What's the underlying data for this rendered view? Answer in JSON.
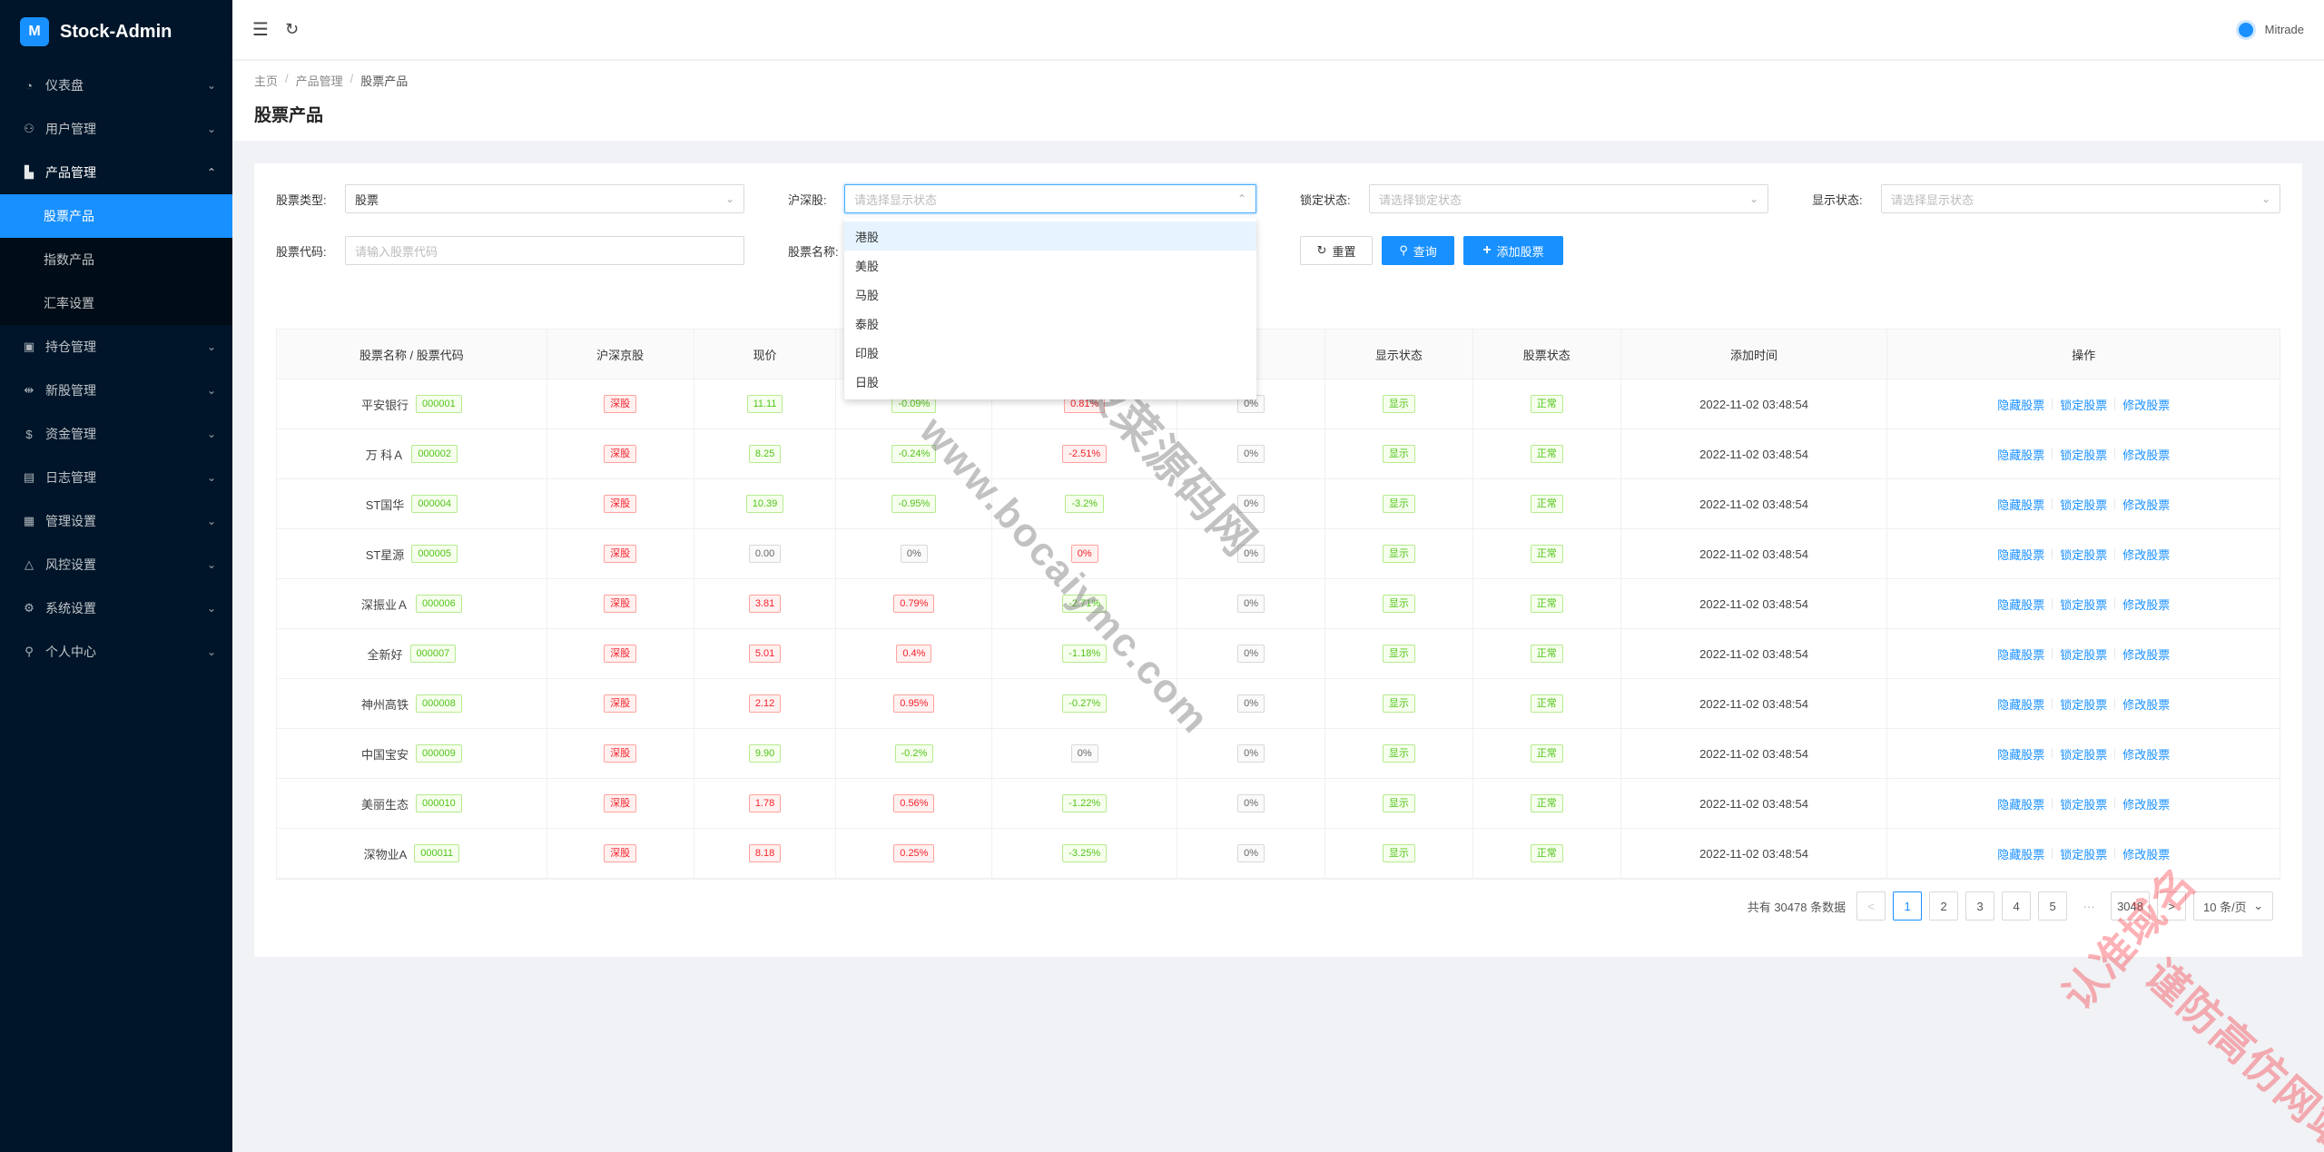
{
  "app": {
    "title": "Stock-Admin",
    "logo_letter": "M"
  },
  "sidebar": {
    "items": [
      {
        "label": "仪表盘",
        "icon": "dashboard-icon",
        "glyph": "◔",
        "arrow": "⌄"
      },
      {
        "label": "用户管理",
        "icon": "users-icon",
        "glyph": "⚇",
        "arrow": "⌄"
      },
      {
        "label": "产品管理",
        "icon": "chart-icon",
        "glyph": "▙",
        "arrow": "⌃"
      },
      {
        "label": "持仓管理",
        "icon": "position-icon",
        "glyph": "▣",
        "arrow": "⌄"
      },
      {
        "label": "新股管理",
        "icon": "ipo-icon",
        "glyph": "⇹",
        "arrow": "⌄"
      },
      {
        "label": "资金管理",
        "icon": "money-icon",
        "glyph": "$",
        "arrow": "⌄"
      },
      {
        "label": "日志管理",
        "icon": "log-icon",
        "glyph": "▤",
        "arrow": "⌄"
      },
      {
        "label": "管理设置",
        "icon": "settings-panel-icon",
        "glyph": "▦",
        "arrow": "⌄"
      },
      {
        "label": "风控设置",
        "icon": "warning-icon",
        "glyph": "△",
        "arrow": "⌄"
      },
      {
        "label": "系统设置",
        "icon": "gear-icon",
        "glyph": "⚙",
        "arrow": "⌄"
      },
      {
        "label": "个人中心",
        "icon": "user-icon",
        "glyph": "⚲",
        "arrow": "⌄"
      }
    ],
    "submenu": [
      {
        "label": "股票产品",
        "active": true
      },
      {
        "label": "指数产品",
        "active": false
      },
      {
        "label": "汇率设置",
        "active": false
      }
    ]
  },
  "header": {
    "menu_fold_glyph": "☰",
    "refresh_glyph": "↻",
    "username": "Mitrade"
  },
  "breadcrumb": {
    "home": "主页",
    "section": "产品管理",
    "current": "股票产品",
    "sep": "/"
  },
  "page_title": "股票产品",
  "filters": {
    "stock_type_label": "股票类型:",
    "stock_type_value": "股票",
    "hs_label": "沪深股:",
    "hs_placeholder": "请选择显示状态",
    "lock_label": "锁定状态:",
    "lock_placeholder": "请选择锁定状态",
    "show_label": "显示状态:",
    "show_placeholder": "请选择显示状态",
    "code_label": "股票代码:",
    "code_placeholder": "请输入股票代码",
    "name_label": "股票名称:",
    "chevron": "⌄",
    "chevron_up": "⌃"
  },
  "buttons": {
    "reset": "重置",
    "reset_glyph": "↻",
    "search": "查询",
    "search_glyph": "⚲",
    "add": "添加股票",
    "add_glyph": "+"
  },
  "dropdown": {
    "options": [
      "港股",
      "美股",
      "马股",
      "泰股",
      "印股",
      "日股"
    ]
  },
  "table": {
    "headers": [
      "股票名称 / 股票代码",
      "沪深京股",
      "现价",
      "",
      "",
      "率",
      "显示状态",
      "股票状态",
      "添加时间",
      "操作"
    ],
    "rows": [
      {
        "name": "平安银行",
        "code": "000001",
        "market": "深股",
        "price": "11.11",
        "price_c": "green",
        "chg": "-0.09%",
        "chg_c": "green",
        "v2": "0.81%",
        "v2_c": "red",
        "rate": "0%",
        "show": "显示",
        "status": "正常",
        "time": "2022-11-02 03:48:54"
      },
      {
        "name": "万 科Ａ",
        "code": "000002",
        "market": "深股",
        "price": "8.25",
        "price_c": "green",
        "chg": "-0.24%",
        "chg_c": "green",
        "v2": "-2.51%",
        "v2_c": "red",
        "rate": "0%",
        "show": "显示",
        "status": "正常",
        "time": "2022-11-02 03:48:54"
      },
      {
        "name": "ST国华",
        "code": "000004",
        "market": "深股",
        "price": "10.39",
        "price_c": "green",
        "chg": "-0.95%",
        "chg_c": "green",
        "v2": "-3.2%",
        "v2_c": "green",
        "rate": "0%",
        "show": "显示",
        "status": "正常",
        "time": "2022-11-02 03:48:54"
      },
      {
        "name": "ST星源",
        "code": "000005",
        "market": "深股",
        "price": "0.00",
        "price_c": "gray",
        "chg": "0%",
        "chg_c": "gray",
        "v2": "0%",
        "v2_c": "red",
        "rate": "0%",
        "show": "显示",
        "status": "正常",
        "time": "2022-11-02 03:48:54"
      },
      {
        "name": "深振业Ａ",
        "code": "000006",
        "market": "深股",
        "price": "3.81",
        "price_c": "red",
        "chg": "0.79%",
        "chg_c": "red",
        "v2": "-2.71%",
        "v2_c": "green",
        "rate": "0%",
        "show": "显示",
        "status": "正常",
        "time": "2022-11-02 03:48:54"
      },
      {
        "name": "全新好",
        "code": "000007",
        "market": "深股",
        "price": "5.01",
        "price_c": "red",
        "chg": "0.4%",
        "chg_c": "red",
        "v2": "-1.18%",
        "v2_c": "green",
        "rate": "0%",
        "show": "显示",
        "status": "正常",
        "time": "2022-11-02 03:48:54"
      },
      {
        "name": "神州高铁",
        "code": "000008",
        "market": "深股",
        "price": "2.12",
        "price_c": "red",
        "chg": "0.95%",
        "chg_c": "red",
        "v2": "-0.27%",
        "v2_c": "green",
        "rate": "0%",
        "show": "显示",
        "status": "正常",
        "time": "2022-11-02 03:48:54"
      },
      {
        "name": "中国宝安",
        "code": "000009",
        "market": "深股",
        "price": "9.90",
        "price_c": "green",
        "chg": "-0.2%",
        "chg_c": "green",
        "v2": "0%",
        "v2_c": "gray",
        "rate": "0%",
        "show": "显示",
        "status": "正常",
        "time": "2022-11-02 03:48:54"
      },
      {
        "name": "美丽生态",
        "code": "000010",
        "market": "深股",
        "price": "1.78",
        "price_c": "red",
        "chg": "0.56%",
        "chg_c": "red",
        "v2": "-1.22%",
        "v2_c": "green",
        "rate": "0%",
        "show": "显示",
        "status": "正常",
        "time": "2022-11-02 03:48:54"
      },
      {
        "name": "深物业A",
        "code": "000011",
        "market": "深股",
        "price": "8.18",
        "price_c": "red",
        "chg": "0.25%",
        "chg_c": "red",
        "v2": "-3.25%",
        "v2_c": "green",
        "rate": "0%",
        "show": "显示",
        "status": "正常",
        "time": "2022-11-02 03:48:54"
      }
    ],
    "actions": [
      "隐藏股票",
      "锁定股票",
      "修改股票"
    ]
  },
  "pagination": {
    "total": "共有 30478 条数据",
    "prev": "<",
    "next": ">",
    "pages": [
      "1",
      "2",
      "3",
      "4",
      "5"
    ],
    "ellipsis": "···",
    "last": "3048",
    "page_size": "10 条/页",
    "current": 1
  },
  "watermarks": {
    "main": "www.bocaiymc.com",
    "main_cn": "菠菜源码网",
    "corner1": "认准域名",
    "corner2": "谨防高仿网站"
  },
  "colors": {
    "sidebar_bg": "#001529",
    "accent": "#1890ff"
  }
}
